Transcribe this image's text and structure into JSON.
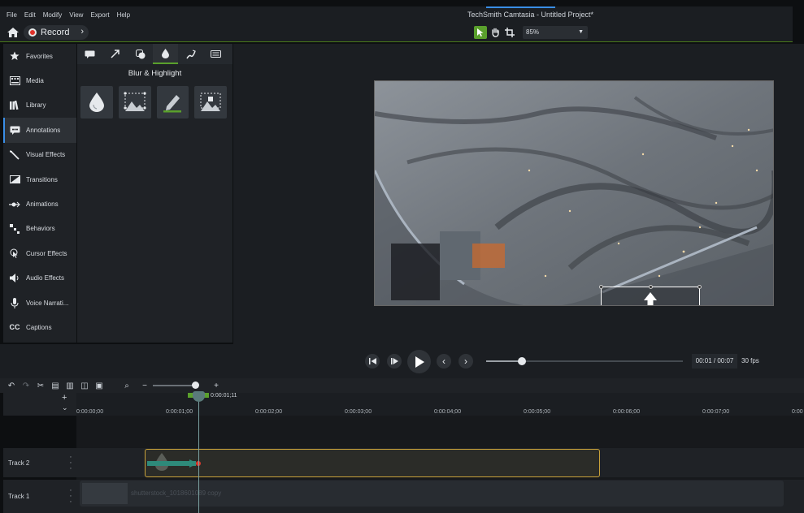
{
  "menu": [
    "File",
    "Edit",
    "Modify",
    "View",
    "Export",
    "Help"
  ],
  "app_title": "TechSmith Camtasia - Untitled Project*",
  "toolbar": {
    "record_label": "Record",
    "zoom_value": "85%"
  },
  "sidebar": {
    "items": [
      {
        "label": "Favorites",
        "icon": "star-icon"
      },
      {
        "label": "Media",
        "icon": "film-icon"
      },
      {
        "label": "Library",
        "icon": "library-icon"
      },
      {
        "label": "Annotations",
        "icon": "annotation-icon"
      },
      {
        "label": "Visual Effects",
        "icon": "wand-icon"
      },
      {
        "label": "Transitions",
        "icon": "transition-icon"
      },
      {
        "label": "Animations",
        "icon": "animation-icon"
      },
      {
        "label": "Behaviors",
        "icon": "behavior-icon"
      },
      {
        "label": "Cursor Effects",
        "icon": "cursor-icon"
      },
      {
        "label": "Audio Effects",
        "icon": "speaker-icon"
      },
      {
        "label": "Voice Narrati...",
        "icon": "microphone-icon"
      },
      {
        "label": "Captions",
        "icon": "captions-icon"
      }
    ],
    "active_index": 3
  },
  "panel": {
    "title": "Blur & Highlight",
    "tabs": [
      "callout-icon",
      "arrow-icon",
      "shape-icon",
      "blur-icon",
      "sketch-icon",
      "keyboard-icon"
    ],
    "active_tab": 3,
    "tiles": [
      "blur-drop-icon",
      "spotlight-icon",
      "highlight-pen-icon",
      "interactive-hotspot-icon"
    ]
  },
  "playback": {
    "timecode": "00:01 / 00:07",
    "fps": "30 fps",
    "progress": 0.18
  },
  "timeline": {
    "playhead_time": "0:00:01;11",
    "ticks": [
      "0:00:00;00",
      "0:00:01;00",
      "0:00:02;00",
      "0:00:03;00",
      "0:00:04;00",
      "0:00:05;00",
      "0:00:06;00",
      "0:00:07;00",
      "0:00"
    ],
    "tracks": [
      {
        "label": "Track 2"
      },
      {
        "label": "Track 1"
      }
    ],
    "media_clip_label": "shutterstock_1018601089 copy",
    "zoom_level": 0.92
  },
  "colors": {
    "accent_green": "#5aa02c",
    "record_red": "#e0322b",
    "clip_border": "#c9a23a"
  }
}
